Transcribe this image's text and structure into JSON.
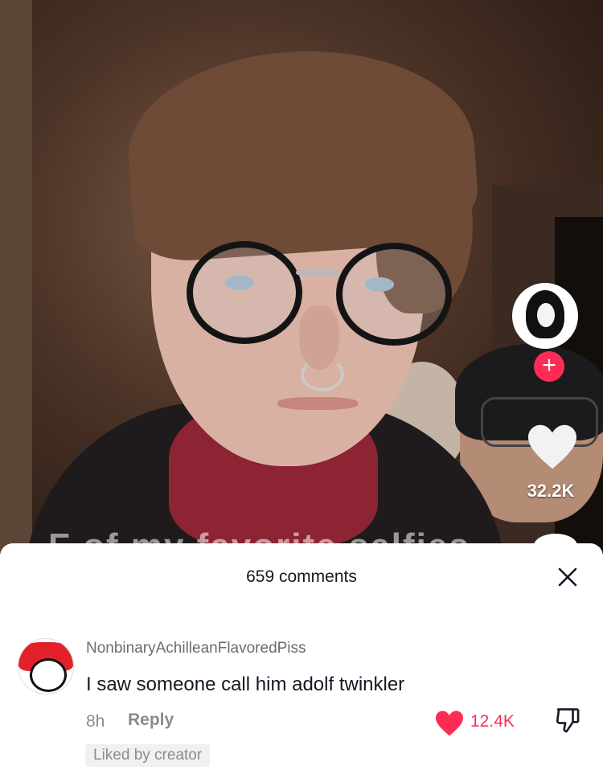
{
  "video": {
    "caption_partial": "F of my favorite selfies",
    "like_count": "32.2K",
    "follow_symbol": "+"
  },
  "comments_sheet": {
    "title": "659 comments",
    "close_symbol": "×",
    "comment": {
      "username": "NonbinaryAchilleanFlavoredPiss",
      "text": "I saw someone call him adolf twinkler",
      "time": "8h",
      "reply_label": "Reply",
      "like_count": "12.4K",
      "badge": "Liked by creator"
    }
  },
  "colors": {
    "accent": "#fe2c55",
    "text": "#161823",
    "muted": "#8a8b91"
  }
}
